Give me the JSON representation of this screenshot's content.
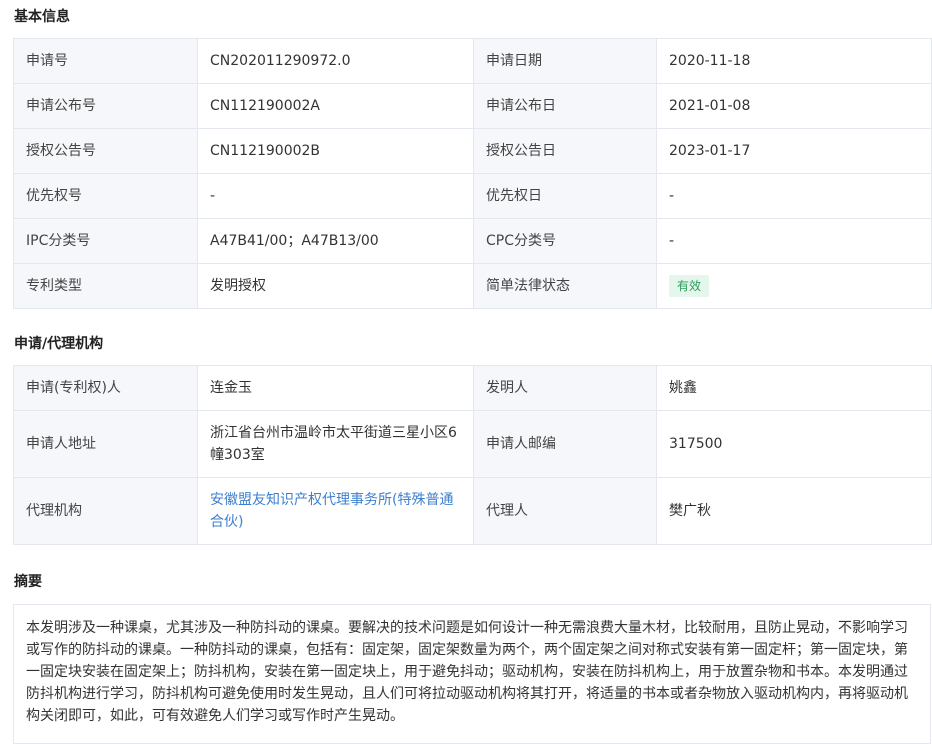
{
  "basic": {
    "title": "基本信息",
    "rows": [
      {
        "l1": "申请号",
        "v1": "CN202011290972.0",
        "l2": "申请日期",
        "v2": "2020-11-18"
      },
      {
        "l1": "申请公布号",
        "v1": "CN112190002A",
        "l2": "申请公布日",
        "v2": "2021-01-08"
      },
      {
        "l1": "授权公告号",
        "v1": "CN112190002B",
        "l2": "授权公告日",
        "v2": "2023-01-17"
      },
      {
        "l1": "优先权号",
        "v1": "-",
        "l2": "优先权日",
        "v2": "-"
      },
      {
        "l1": "IPC分类号",
        "v1": "A47B41/00；A47B13/00",
        "l2": "CPC分类号",
        "v2": "-"
      },
      {
        "l1": "专利类型",
        "v1": "发明授权",
        "l2": "简单法律状态",
        "v2": "有效"
      }
    ],
    "status_color": "#2e9c5b",
    "status_bg": "#e5f6ec"
  },
  "agency": {
    "title": "申请/代理机构",
    "rows": [
      {
        "l1": "申请(专利权)人",
        "v1": "连金玉",
        "l2": "发明人",
        "v2": "姚鑫"
      },
      {
        "l1": "申请人地址",
        "v1": "浙江省台州市温岭市太平街道三星小区6幢303室",
        "l2": "申请人邮编",
        "v2": "317500"
      },
      {
        "l1": "代理机构",
        "v1": "安徽盟友知识产权代理事务所(特殊普通合伙)",
        "l2": "代理人",
        "v2": "樊广秋"
      }
    ],
    "link_color": "#3d7fd0"
  },
  "abstract": {
    "title": "摘要",
    "text": "本发明涉及一种课桌，尤其涉及一种防抖动的课桌。要解决的技术问题是如何设计一种无需浪费大量木材，比较耐用，且防止晃动，不影响学习或写作的防抖动的课桌。一种防抖动的课桌，包括有：固定架，固定架数量为两个，两个固定架之间对称式安装有第一固定杆；第一固定块，第一固定块安装在固定架上；防抖机构，安装在第一固定块上，用于避免抖动；驱动机构，安装在防抖机构上，用于放置杂物和书本。本发明通过防抖机构进行学习，防抖机构可避免使用时发生晃动，且人们可将拉动驱动机构将其打开，将适量的书本或者杂物放入驱动机构内，再将驱动机构关闭即可，如此，可有效避免人们学习或写作时产生晃动。"
  }
}
